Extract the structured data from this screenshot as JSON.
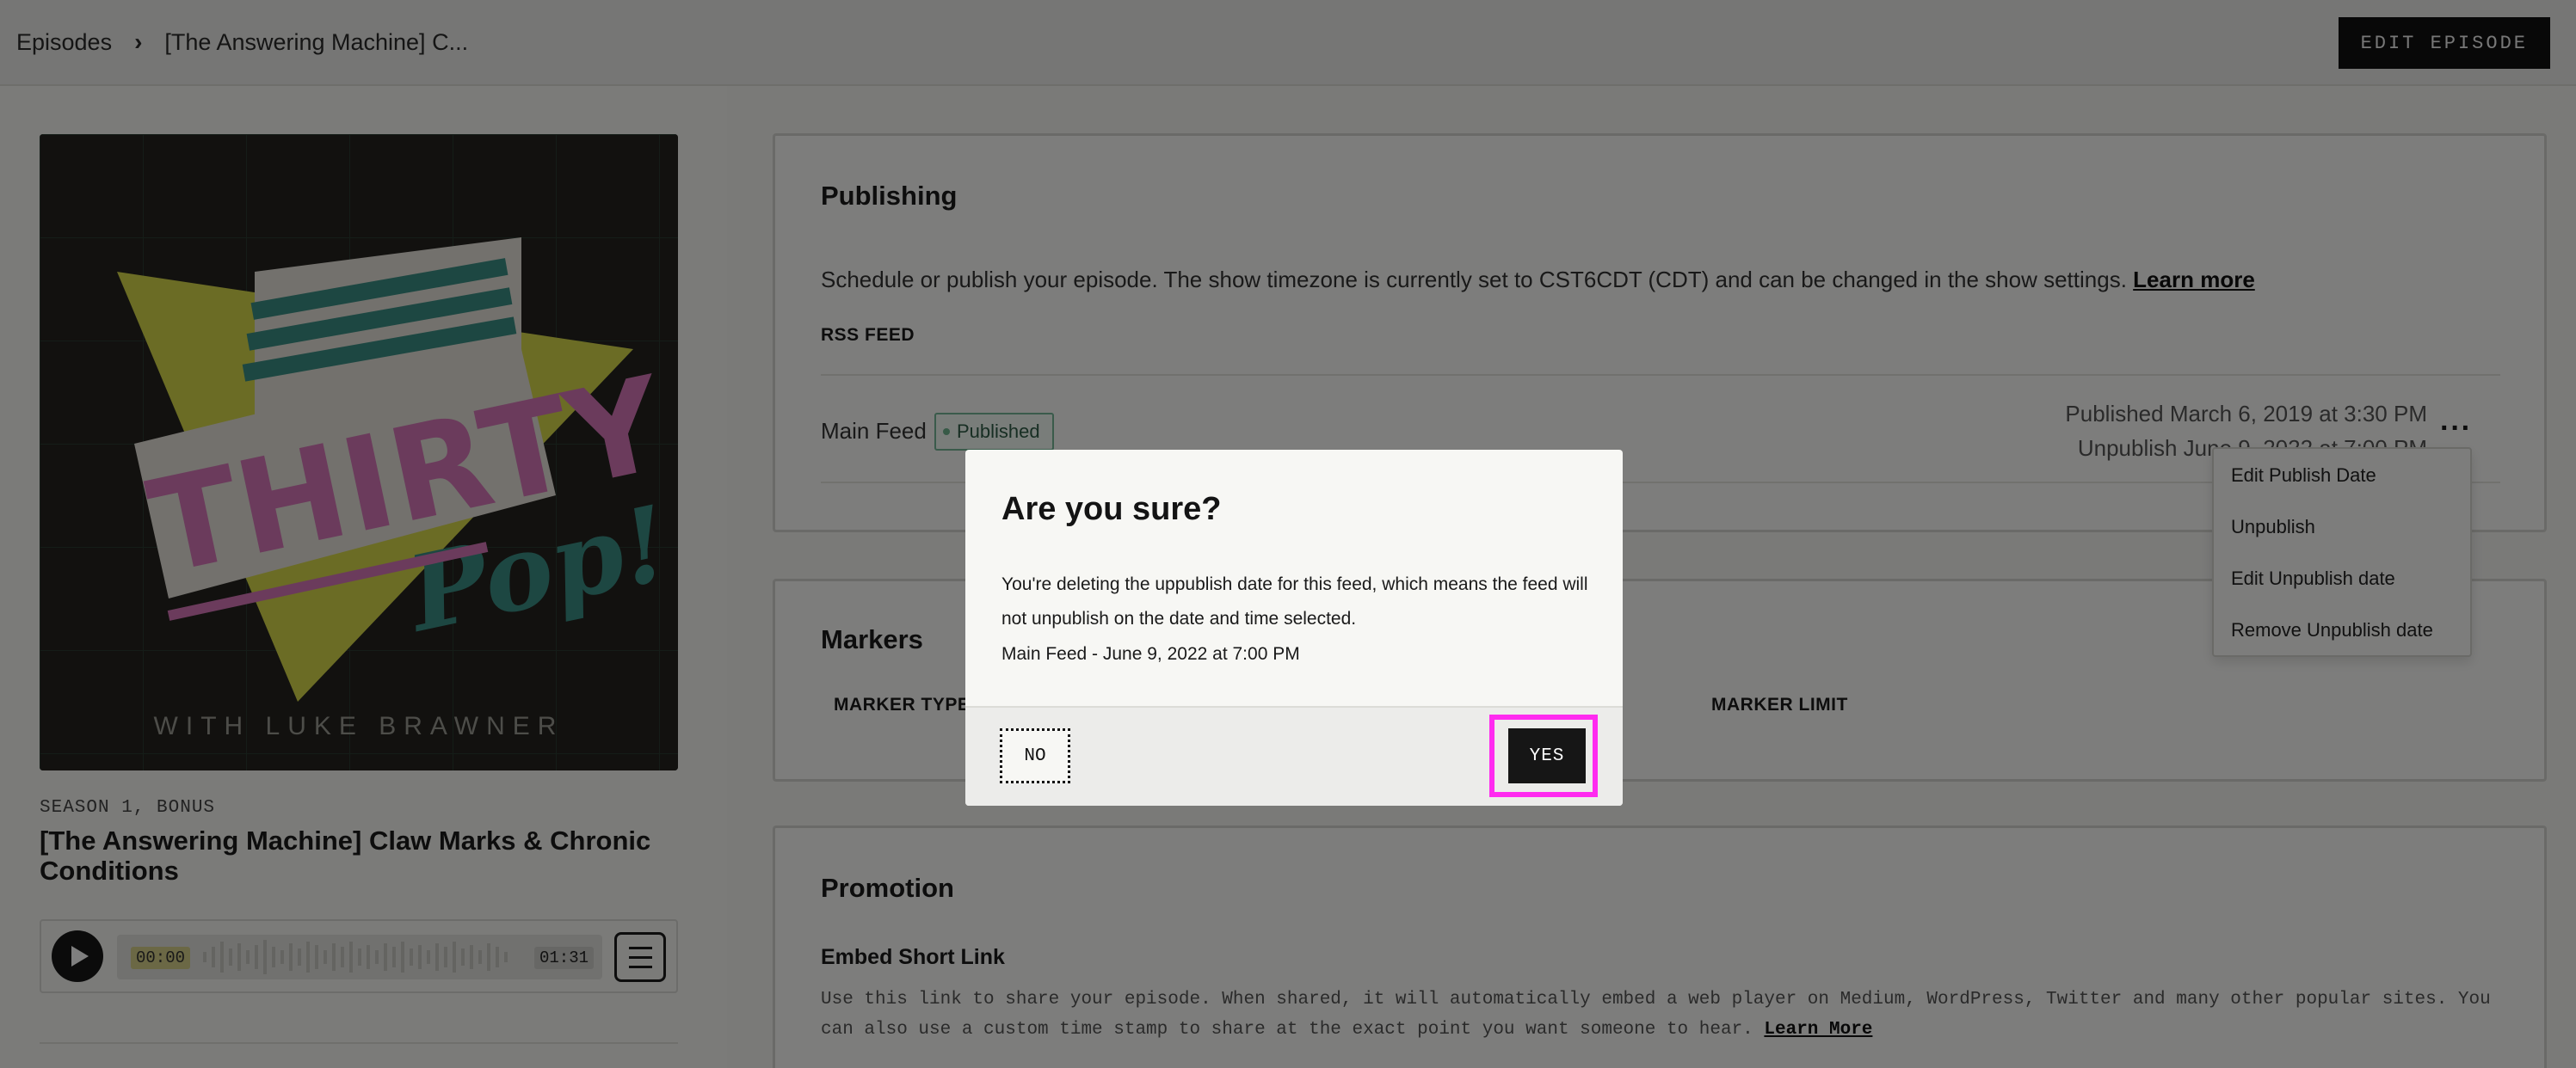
{
  "topbar": {
    "breadcrumb_root": "Episodes",
    "breadcrumb_current": "[The Answering Machine] C...",
    "edit_episode_label": "EDIT EPISODE"
  },
  "episode": {
    "artwork_caption": "WITH LUKE BRAWNER",
    "season": "SEASON 1, BONUS",
    "title": "[The Answering Machine] Claw Marks & Chronic Conditions"
  },
  "player": {
    "current_time": "00:00",
    "duration": "01:31"
  },
  "publishing": {
    "title": "Publishing",
    "description": "Schedule or publish your episode. The show timezone is currently set to CST6CDT (CDT) and can be changed in the show settings.",
    "learn_more": "Learn more",
    "rss_label": "RSS FEED",
    "feed_name": "Main Feed",
    "status": "Published",
    "published_at": "Published March 6, 2019 at 3:30 PM",
    "unpublish_at": "Unpublish June 9, 2022 at 7:00 PM"
  },
  "feed_menu": {
    "items": [
      "Edit Publish Date",
      "Unpublish",
      "Edit Unpublish date",
      "Remove Unpublish date"
    ]
  },
  "markers": {
    "title": "Markers",
    "col_type": "MARKER TYPE",
    "col_limit": "MARKER LIMIT"
  },
  "promotion": {
    "title": "Promotion",
    "embed_title": "Embed Short Link",
    "embed_desc": "Use this link to share your episode. When shared, it will automatically embed a web player on Medium, WordPress, Twitter and many other popular sites. You can also use a custom time stamp to share at the exact point you want someone to hear.",
    "learn_more": "Learn More"
  },
  "modal": {
    "title": "Are you sure?",
    "body": "You're deleting the uppublish date for this feed, which means the feed will not unpublish on the date and time selected.",
    "feed_line": "Main Feed - June 9, 2022 at 7:00 PM",
    "no_label": "NO",
    "yes_label": "YES"
  },
  "colors": {
    "highlight": "#ff2bf0",
    "primary_button": "#161616",
    "published_badge": "#74b697"
  }
}
